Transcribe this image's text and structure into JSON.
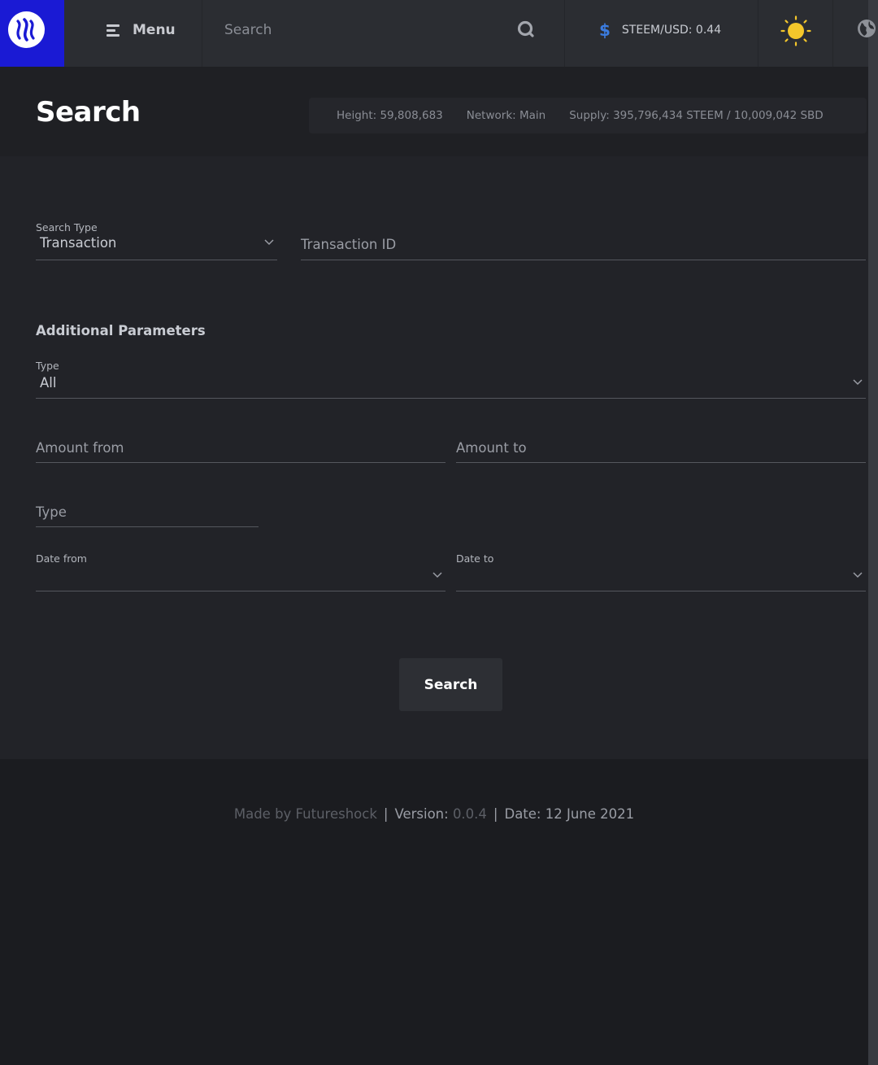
{
  "topbar": {
    "menu_label": "Menu",
    "search_placeholder": "Search",
    "price_label": "STEEM/USD: 0.44",
    "icons": {
      "logo": "steem-logo-icon",
      "menu": "menu-icon",
      "search": "search-icon",
      "price": "dollar-icon",
      "theme": "sun-icon",
      "language": "globe-icon"
    },
    "colors": {
      "logo_bg": "#1a1ad4",
      "dollar": "#3b7ce0",
      "sun": "#f4c72b"
    }
  },
  "header": {
    "title": "Search",
    "stats": {
      "height": "Height: 59,808,683",
      "network": "Network: Main",
      "supply": "Supply: 395,796,434 STEEM / 10,009,042 SBD"
    }
  },
  "form": {
    "search_type": {
      "label": "Search Type",
      "value": "Transaction"
    },
    "transaction_id": {
      "placeholder": "Transaction ID"
    },
    "additional_title": "Additional Parameters",
    "type_select": {
      "label": "Type",
      "value": "All"
    },
    "amount_from": {
      "placeholder": "Amount from"
    },
    "amount_to": {
      "placeholder": "Amount to"
    },
    "type_input": {
      "placeholder": "Type"
    },
    "date_from": {
      "label": "Date from",
      "value": ""
    },
    "date_to": {
      "label": "Date to",
      "value": ""
    },
    "submit_label": "Search"
  },
  "footer": {
    "made_by": "Made by Futureshock",
    "version_label": "Version:",
    "version_value": "0.0.4",
    "date": "Date: 12 June 2021"
  }
}
